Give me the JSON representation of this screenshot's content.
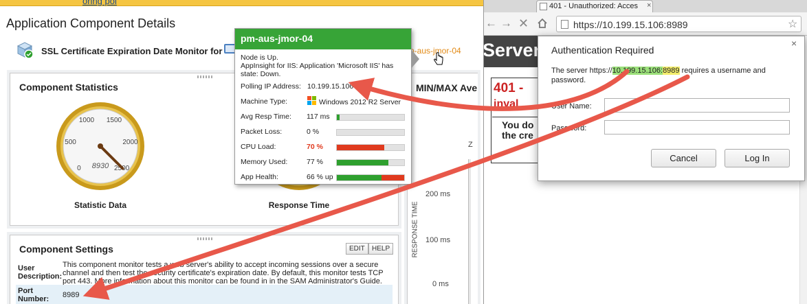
{
  "app_page": {
    "top_strip_text": "oring pol",
    "title": "Application Component Details",
    "monitor_title": "SSL Certificate Expiration Date Monitor for",
    "node_link_text": "n-aus-jmor-04"
  },
  "stats_panel": {
    "title": "Component Statistics",
    "gauge1": {
      "ticks": [
        "0",
        "500",
        "1000",
        "1500",
        "2000",
        "2500"
      ],
      "min": 0,
      "max": 2500,
      "value": 8930,
      "value_label": "8930",
      "caption": "Statistic Data"
    },
    "gauge2": {
      "caption": "Response Time"
    }
  },
  "minmax_panel": {
    "title": "MIN/MAX Ave",
    "zoom_label": "Z",
    "axis_title": "RESPONSE TIME",
    "ticks": [
      "200 ms",
      "100 ms",
      "0 ms"
    ]
  },
  "settings_panel": {
    "title": "Component Settings",
    "edit_label": "EDIT",
    "help_label": "HELP",
    "user_description_label": "User Description:",
    "user_description_value": "This component monitor tests a web server's ability to accept incoming sessions over a secure channel and then test the security certificate's expiration date. By default, this monitor tests TCP port 443. More information about this monitor can be found in in the SAM Administrator's Guide.",
    "port_label": "Port Number:",
    "port_value": "8989"
  },
  "tooltip": {
    "node_name": "pm-aus-jmor-04",
    "status_lines": [
      "Node is Up.",
      "AppInsight for IIS: Application 'Microsoft IIS' has state: Down."
    ],
    "polling_ip_label": "Polling IP Address:",
    "polling_ip_value": "10.199.15.106",
    "machine_type_label": "Machine Type:",
    "machine_type_value": "Windows 2012 R2 Server",
    "metrics": [
      {
        "label": "Avg Resp Time:",
        "value": "117 ms",
        "fill": 0.04,
        "color": "#2ea02e",
        "warn": false
      },
      {
        "label": "Packet Loss:",
        "value": "0 %",
        "fill": 0.0,
        "color": "#2ea02e",
        "warn": false
      },
      {
        "label": "CPU Load:",
        "value": "70 %",
        "fill": 0.7,
        "color": "#e03a1e",
        "warn": true
      },
      {
        "label": "Memory Used:",
        "value": "77 %",
        "fill": 0.77,
        "color": "#2ea02e",
        "warn": false
      },
      {
        "label": "App Health:",
        "value": "66 % up",
        "fill": 0.66,
        "color": "#2ea02e",
        "remainder_color": "#e03a1e",
        "warn": false
      }
    ],
    "colors": {
      "header": "#37a437",
      "warn_text": "#e03a1e"
    }
  },
  "browser": {
    "tab_title": "401 - Unauthorized: Acces",
    "url": "https://10.199.15.106:8989",
    "page": {
      "banner_text": "Server",
      "error_title": "401 -",
      "error_title_line2": "inval",
      "error_body_line1": "You do",
      "error_body_line2": "the cre"
    }
  },
  "auth_dialog": {
    "title": "Authentication Required",
    "message_prefix": "The server https://",
    "message_host": "10.199.15.106:",
    "message_port": "8989",
    "message_suffix": " requires a username and password.",
    "username_label": "User Name:",
    "password_label": "Password:",
    "cancel_label": "Cancel",
    "login_label": "Log In",
    "username_value": "",
    "password_value": "",
    "highlight_colors": {
      "host": "#9be07a",
      "port": "#f4ee6c"
    }
  },
  "annotation_color": "#e8584a"
}
